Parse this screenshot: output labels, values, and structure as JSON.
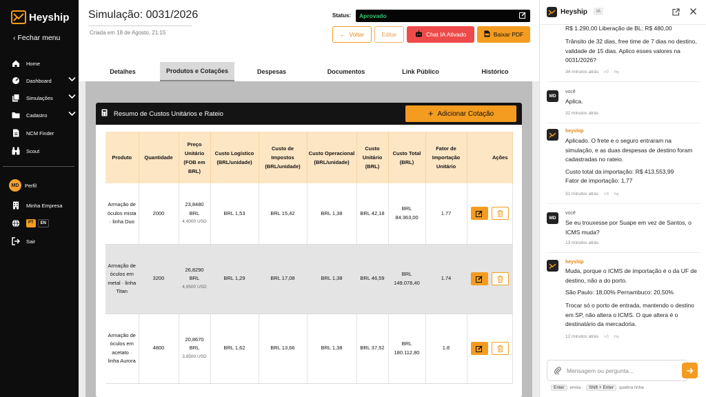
{
  "sidebar": {
    "brand": "Heyship",
    "close_menu": "Fechar menu",
    "items": [
      {
        "label": "Home"
      },
      {
        "label": "Dashboard"
      },
      {
        "label": "Simulações"
      },
      {
        "label": "Cadastro"
      },
      {
        "label": "NCM Finder"
      },
      {
        "label": "Scout"
      }
    ],
    "profile_initials": "MD",
    "profile": "Perfil",
    "company": "Minha Empresa",
    "lang_pt": "PT",
    "lang_en": "EN",
    "logout": "Sair"
  },
  "header": {
    "title": "Simulação: 0031/2026",
    "created": "Criada em 18 de Agosto, 21:15",
    "status_label": "Status:",
    "status_value": "Aprovado",
    "btn_voltar": "Voltar",
    "btn_editar": "Editar",
    "btn_chat": "Chat IA Ativado",
    "btn_pdf": "Baixar PDF"
  },
  "tabs": [
    {
      "label": "Detalhes"
    },
    {
      "label": "Produtos e Cotações"
    },
    {
      "label": "Despesas"
    },
    {
      "label": "Documentos"
    },
    {
      "label": "Link Público"
    },
    {
      "label": "Histórico"
    }
  ],
  "card": {
    "title": "Resumo de Custos Unitários e Rateio",
    "add_button": "Adicionar Cotação",
    "columns": [
      "Produto",
      "Quantidade",
      "Preço Unitário (FOB em BRL)",
      "Custo Logístico (BRL/unidade)",
      "Custo de Impostos (BRL/unidade)",
      "Custo Operacional (BRL/unidade)",
      "Custo Unitário (BRL)",
      "Custo Total (BRL)",
      "Fator de Importação Unitário",
      "Ações"
    ],
    "rows": [
      {
        "produto": "Armação de óculos mista · linha Duo",
        "quantidade": "2000",
        "preco_brl": "23,8480 BRL",
        "preco_usd": "4,4000 USD",
        "logistico": "BRL 1,53",
        "impostos": "BRL 15,42",
        "operacional": "BRL 1,38",
        "unitario": "BRL 42,18",
        "total": "BRL 84.363,00",
        "fator": "1.77"
      },
      {
        "produto": "Armação de óculos em metal · linha Titan",
        "quantidade": "3200",
        "preco_brl": "26,8290 BRL",
        "preco_usd": "4,9500 USD",
        "logistico": "BRL 1,29",
        "impostos": "BRL 17,08",
        "operacional": "BRL 1,38",
        "unitario": "BRL 46,59",
        "total": "BRL 149.078,40",
        "fator": "1.74"
      },
      {
        "produto": "Armação de óculos em acetato · linha Aurora",
        "quantidade": "4800",
        "preco_brl": "20,8670 BRL",
        "preco_usd": "3,8500 USD",
        "logistico": "BRL 1,62",
        "impostos": "BRL 13,66",
        "operacional": "BRL 1,38",
        "unitario": "BRL 37,52",
        "total": "BRL 180.112,80",
        "fator": "1.8"
      }
    ]
  },
  "chat": {
    "title": "Heyship",
    "badge": "IA",
    "messages": [
      {
        "sender": "",
        "lines": [
          "R$ 1.290,00 Liberação de BL: R$ 480,00",
          "Trânsito de 32 dias, free time de 7 dias no destino, validade de 15 dias. Aplico esses valores na 0031/2026?"
        ],
        "time": "34 minutos atrás"
      },
      {
        "sender": "você",
        "initials": "MD",
        "lines": [
          "Aplica."
        ],
        "time": "32 minutos atrás"
      },
      {
        "sender": "heyship",
        "lines": [
          "Aplicado. O frete e o seguro entraram na simulação, e as duas despesas de destino foram cadastradas no rateio.",
          "Custo total da importação: R$ 413.553,99",
          "Fator de importação: 1,77"
        ],
        "time": "31 minutos atrás"
      },
      {
        "sender": "você",
        "initials": "MD",
        "lines": [
          "Se eu trouxesse por Suape em vez de Santos, o ICMS muda?"
        ],
        "time": "13 minutos atrás"
      },
      {
        "sender": "heyship",
        "lines": [
          "Muda, porque o ICMS de importação é o da UF de destino, não a do porto.",
          "São Paulo: 18,00% Pernambuco: 20,50%",
          "Trocar só o porto de entrada, mantendo o destino em SP, não altera o ICMS. O que altera é o destinatário da mercadoria."
        ],
        "time": "12 minutos atrás"
      }
    ],
    "placeholder": "Mensagem ou pergunta...",
    "hint_enter": "Enter",
    "hint_envia": "envia ·",
    "hint_shift": "Shift + Enter",
    "hint_quebra": "quebra linha"
  }
}
